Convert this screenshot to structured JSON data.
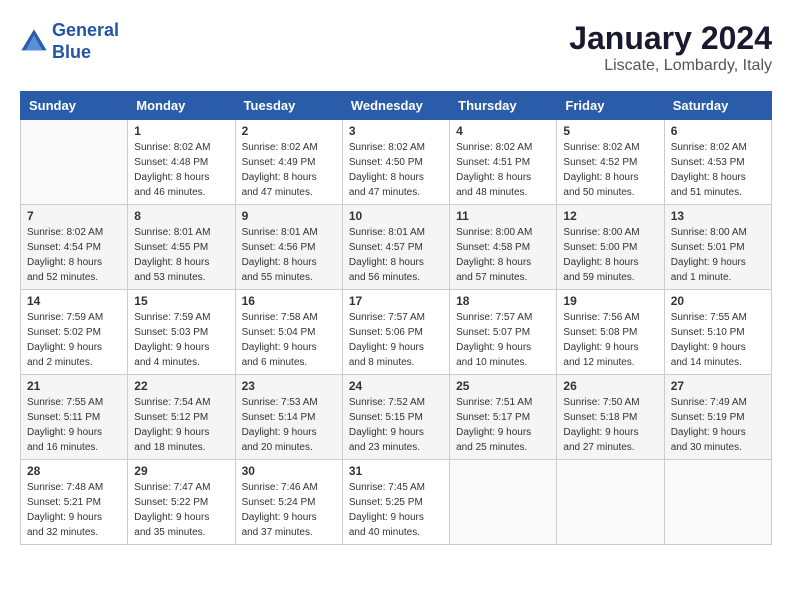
{
  "logo": {
    "line1": "General",
    "line2": "Blue"
  },
  "title": "January 2024",
  "subtitle": "Liscate, Lombardy, Italy",
  "weekdays": [
    "Sunday",
    "Monday",
    "Tuesday",
    "Wednesday",
    "Thursday",
    "Friday",
    "Saturday"
  ],
  "weeks": [
    [
      {
        "day": "",
        "info": ""
      },
      {
        "day": "1",
        "info": "Sunrise: 8:02 AM\nSunset: 4:48 PM\nDaylight: 8 hours\nand 46 minutes."
      },
      {
        "day": "2",
        "info": "Sunrise: 8:02 AM\nSunset: 4:49 PM\nDaylight: 8 hours\nand 47 minutes."
      },
      {
        "day": "3",
        "info": "Sunrise: 8:02 AM\nSunset: 4:50 PM\nDaylight: 8 hours\nand 47 minutes."
      },
      {
        "day": "4",
        "info": "Sunrise: 8:02 AM\nSunset: 4:51 PM\nDaylight: 8 hours\nand 48 minutes."
      },
      {
        "day": "5",
        "info": "Sunrise: 8:02 AM\nSunset: 4:52 PM\nDaylight: 8 hours\nand 50 minutes."
      },
      {
        "day": "6",
        "info": "Sunrise: 8:02 AM\nSunset: 4:53 PM\nDaylight: 8 hours\nand 51 minutes."
      }
    ],
    [
      {
        "day": "7",
        "info": "Sunrise: 8:02 AM\nSunset: 4:54 PM\nDaylight: 8 hours\nand 52 minutes."
      },
      {
        "day": "8",
        "info": "Sunrise: 8:01 AM\nSunset: 4:55 PM\nDaylight: 8 hours\nand 53 minutes."
      },
      {
        "day": "9",
        "info": "Sunrise: 8:01 AM\nSunset: 4:56 PM\nDaylight: 8 hours\nand 55 minutes."
      },
      {
        "day": "10",
        "info": "Sunrise: 8:01 AM\nSunset: 4:57 PM\nDaylight: 8 hours\nand 56 minutes."
      },
      {
        "day": "11",
        "info": "Sunrise: 8:00 AM\nSunset: 4:58 PM\nDaylight: 8 hours\nand 57 minutes."
      },
      {
        "day": "12",
        "info": "Sunrise: 8:00 AM\nSunset: 5:00 PM\nDaylight: 8 hours\nand 59 minutes."
      },
      {
        "day": "13",
        "info": "Sunrise: 8:00 AM\nSunset: 5:01 PM\nDaylight: 9 hours\nand 1 minute."
      }
    ],
    [
      {
        "day": "14",
        "info": "Sunrise: 7:59 AM\nSunset: 5:02 PM\nDaylight: 9 hours\nand 2 minutes."
      },
      {
        "day": "15",
        "info": "Sunrise: 7:59 AM\nSunset: 5:03 PM\nDaylight: 9 hours\nand 4 minutes."
      },
      {
        "day": "16",
        "info": "Sunrise: 7:58 AM\nSunset: 5:04 PM\nDaylight: 9 hours\nand 6 minutes."
      },
      {
        "day": "17",
        "info": "Sunrise: 7:57 AM\nSunset: 5:06 PM\nDaylight: 9 hours\nand 8 minutes."
      },
      {
        "day": "18",
        "info": "Sunrise: 7:57 AM\nSunset: 5:07 PM\nDaylight: 9 hours\nand 10 minutes."
      },
      {
        "day": "19",
        "info": "Sunrise: 7:56 AM\nSunset: 5:08 PM\nDaylight: 9 hours\nand 12 minutes."
      },
      {
        "day": "20",
        "info": "Sunrise: 7:55 AM\nSunset: 5:10 PM\nDaylight: 9 hours\nand 14 minutes."
      }
    ],
    [
      {
        "day": "21",
        "info": "Sunrise: 7:55 AM\nSunset: 5:11 PM\nDaylight: 9 hours\nand 16 minutes."
      },
      {
        "day": "22",
        "info": "Sunrise: 7:54 AM\nSunset: 5:12 PM\nDaylight: 9 hours\nand 18 minutes."
      },
      {
        "day": "23",
        "info": "Sunrise: 7:53 AM\nSunset: 5:14 PM\nDaylight: 9 hours\nand 20 minutes."
      },
      {
        "day": "24",
        "info": "Sunrise: 7:52 AM\nSunset: 5:15 PM\nDaylight: 9 hours\nand 23 minutes."
      },
      {
        "day": "25",
        "info": "Sunrise: 7:51 AM\nSunset: 5:17 PM\nDaylight: 9 hours\nand 25 minutes."
      },
      {
        "day": "26",
        "info": "Sunrise: 7:50 AM\nSunset: 5:18 PM\nDaylight: 9 hours\nand 27 minutes."
      },
      {
        "day": "27",
        "info": "Sunrise: 7:49 AM\nSunset: 5:19 PM\nDaylight: 9 hours\nand 30 minutes."
      }
    ],
    [
      {
        "day": "28",
        "info": "Sunrise: 7:48 AM\nSunset: 5:21 PM\nDaylight: 9 hours\nand 32 minutes."
      },
      {
        "day": "29",
        "info": "Sunrise: 7:47 AM\nSunset: 5:22 PM\nDaylight: 9 hours\nand 35 minutes."
      },
      {
        "day": "30",
        "info": "Sunrise: 7:46 AM\nSunset: 5:24 PM\nDaylight: 9 hours\nand 37 minutes."
      },
      {
        "day": "31",
        "info": "Sunrise: 7:45 AM\nSunset: 5:25 PM\nDaylight: 9 hours\nand 40 minutes."
      },
      {
        "day": "",
        "info": ""
      },
      {
        "day": "",
        "info": ""
      },
      {
        "day": "",
        "info": ""
      }
    ]
  ]
}
